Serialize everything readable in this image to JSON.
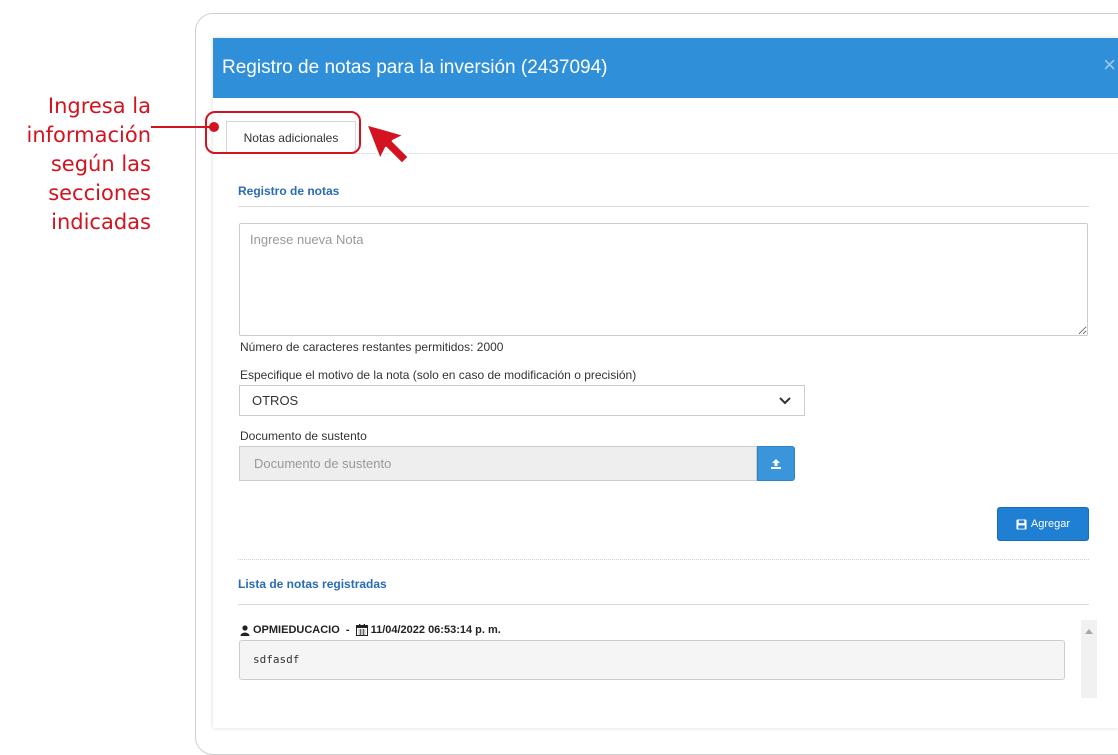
{
  "annotation": {
    "lines": [
      "Ingresa la",
      "información",
      "según las",
      "secciones",
      "indicadas"
    ],
    "color": "#d3131f"
  },
  "modal": {
    "title": "Registro de notas para la inversión (2437094)",
    "close_symbol": "×",
    "header_color": "#2f8fd9"
  },
  "tabs": [
    {
      "label": "Notas adicionales",
      "active": true
    }
  ],
  "form": {
    "section_title": "Registro de notas",
    "note_placeholder": "Ingrese nueva Nota",
    "note_value": "",
    "remaining_chars_text": "Número de caracteres restantes permitidos: 2000",
    "reason_label": "Especifique el motivo de la nota (solo en caso de modificación o precisión)",
    "reason_selected": "OTROS",
    "document_label": "Documento de sustento",
    "document_placeholder": "Documento de sustento",
    "upload_icon": "upload-icon",
    "add_button_label": "Agregar",
    "add_button_icon": "save-icon"
  },
  "notes_list": {
    "section_title": "Lista de notas registradas",
    "items": [
      {
        "user": "OPMIEDUCACIO",
        "separator": " - ",
        "datetime": "11/04/2022 06:53:14 p. m.",
        "text": "sdfasdf"
      }
    ]
  }
}
